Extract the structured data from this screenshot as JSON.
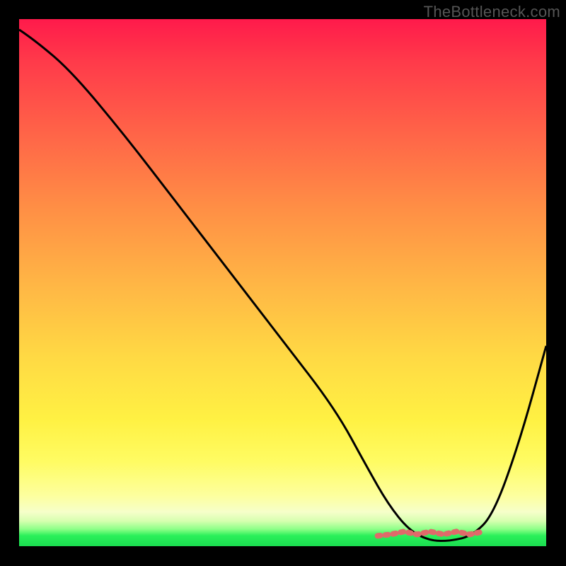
{
  "watermark": "TheBottleneck.com",
  "chart_data": {
    "type": "line",
    "title": "",
    "xlabel": "",
    "ylabel": "",
    "xlim": [
      0,
      100
    ],
    "ylim": [
      0,
      100
    ],
    "series": [
      {
        "name": "curve",
        "x": [
          0,
          3,
          10,
          20,
          30,
          40,
          50,
          60,
          66,
          70,
          74,
          78,
          82,
          86,
          90,
          95,
          100
        ],
        "y": [
          98,
          96,
          90,
          78,
          65,
          52,
          39,
          26,
          15,
          8,
          3,
          1,
          1,
          2,
          6,
          20,
          38
        ]
      }
    ],
    "flat_band": {
      "color": "#e06a6a",
      "x_start": 68,
      "x_end": 88,
      "y": 2.5
    }
  }
}
